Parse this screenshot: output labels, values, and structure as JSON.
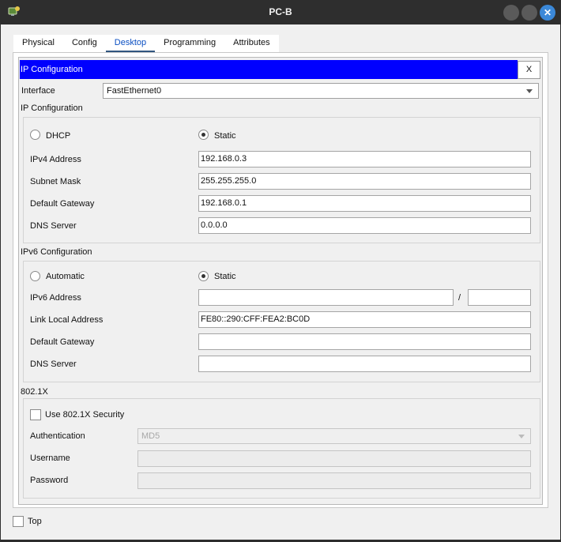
{
  "window": {
    "title": "PC-B",
    "close_glyph": "✕",
    "app_icon": "packet-tracer-pc-icon"
  },
  "tabs": [
    {
      "label": "Physical",
      "active": false
    },
    {
      "label": "Config",
      "active": false
    },
    {
      "label": "Desktop",
      "active": true
    },
    {
      "label": "Programming",
      "active": false
    },
    {
      "label": "Attributes",
      "active": false
    }
  ],
  "header": {
    "title": "IP Configuration",
    "close_label": "X"
  },
  "interface": {
    "label": "Interface",
    "value": "FastEthernet0"
  },
  "ipv4": {
    "section_title": "IP Configuration",
    "dhcp_label": "DHCP",
    "static_label": "Static",
    "mode": "Static",
    "address_label": "IPv4 Address",
    "address_value": "192.168.0.3",
    "mask_label": "Subnet Mask",
    "mask_value": "255.255.255.0",
    "gateway_label": "Default Gateway",
    "gateway_value": "192.168.0.1",
    "dns_label": "DNS Server",
    "dns_value": "0.0.0.0"
  },
  "ipv6": {
    "section_title": "IPv6 Configuration",
    "automatic_label": "Automatic",
    "static_label": "Static",
    "mode": "Static",
    "address_label": "IPv6 Address",
    "address_value": "",
    "separator": "/",
    "prefix_value": "",
    "link_local_label": "Link Local Address",
    "link_local_value": "FE80::290:CFF:FEA2:BC0D",
    "gateway_label": "Default Gateway",
    "gateway_value": "",
    "dns_label": "DNS Server",
    "dns_value": ""
  },
  "dot1x": {
    "section_title": "802.1X",
    "use_label": "Use 802.1X Security",
    "checked": false,
    "auth_label": "Authentication",
    "auth_value": "MD5",
    "username_label": "Username",
    "username_value": "",
    "password_label": "Password",
    "password_value": ""
  },
  "footer": {
    "top_label": "Top",
    "top_checked": false
  },
  "colors": {
    "titlebar": "#2e2e2e",
    "header_bar": "#0000fe",
    "close_button": "#3b88d8",
    "active_tab": "#0b4fc2"
  }
}
